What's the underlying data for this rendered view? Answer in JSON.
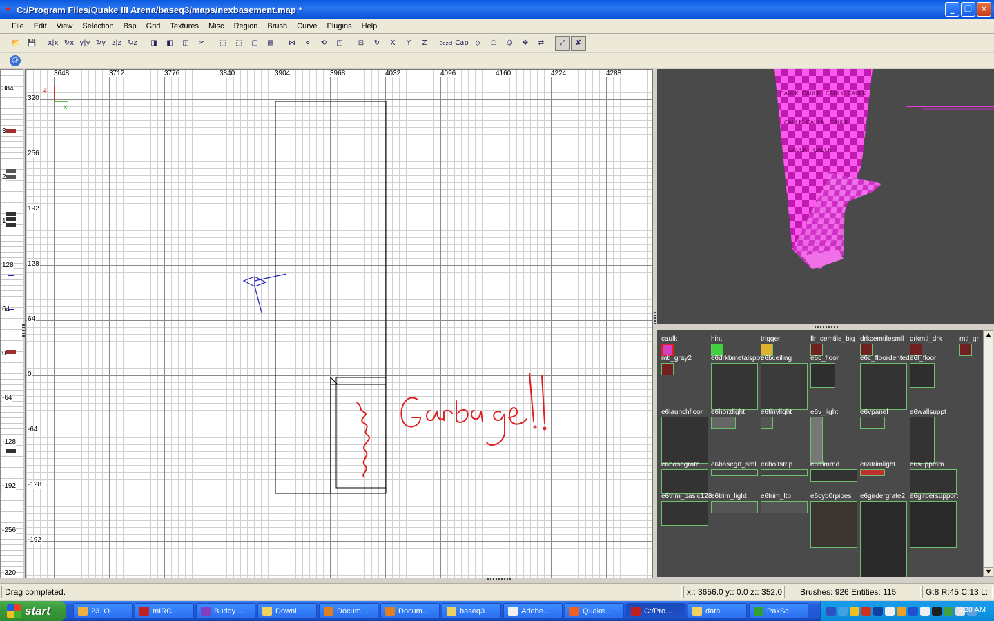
{
  "window": {
    "title": "C:/Program Files/Quake III Arena/baseq3/maps/nexbasement.map *",
    "minimize": "_",
    "maximize": "❐",
    "close": "✕"
  },
  "menu": [
    "File",
    "Edit",
    "View",
    "Selection",
    "Bsp",
    "Grid",
    "Textures",
    "Misc",
    "Region",
    "Brush",
    "Curve",
    "Plugins",
    "Help"
  ],
  "toolbar": {
    "icons": [
      "open-icon",
      "save-icon",
      "flip-x-icon",
      "rotate-x-icon",
      "flip-y-icon",
      "rotate-y-icon",
      "flip-z-icon",
      "rotate-z-icon",
      "csg-subtract-icon",
      "csg-merge-icon",
      "make-hollow-icon",
      "clipper-icon",
      "select-touching-icon",
      "select-partial-icon",
      "select-inside-icon",
      "select-complete-icon",
      "drag-edge-icon",
      "drag-vertex-icon",
      "show-textures-icon",
      "cubic-clip-icon",
      "camera-mode-icon",
      "view-change-icon",
      "view-x-icon",
      "view-y-icon",
      "view-z-icon",
      "show-patch-icon",
      "show-entity-icon",
      "texture-lock-icon",
      "rotate-lock-icon",
      "bend-icon",
      "camera-move-icon",
      "scale-icon",
      "drag-mode-icon",
      "redisperse-icon"
    ],
    "glyphs": [
      "📂",
      "💾",
      "x|x",
      "↻x",
      "y|y",
      "↻y",
      "z|z",
      "↻z",
      "◨",
      "◧",
      "◫",
      "✂",
      "⬚",
      "⬚",
      "▢",
      "▤",
      "⋈",
      "⋄",
      "⟲",
      "◰",
      "⊡",
      "↻",
      "X",
      "Y",
      "Z",
      "Bezel",
      "Cap",
      "◇",
      "☖",
      "⌬",
      "✥",
      "⇄",
      "⤢",
      "✘"
    ],
    "active": [
      32,
      33
    ],
    "patch_icon_glyph": "@"
  },
  "zruler": {
    "labels": [
      "384",
      "3",
      "2",
      "1",
      "128",
      "64",
      "0",
      "-64",
      "-128",
      "-192",
      "-256",
      "-320"
    ]
  },
  "view2d": {
    "x_ticks": [
      "3648",
      "3712",
      "3776",
      "3840",
      "3904",
      "3968",
      "4032",
      "4096",
      "4160",
      "4224",
      "4288"
    ],
    "y_ticks": [
      "320",
      "256",
      "192",
      "128",
      "64",
      "0",
      "-64",
      "-128",
      "-192"
    ],
    "axis_vertical": "z",
    "axis_horizontal": "x",
    "annotation": "Garbage!!"
  },
  "camera": {
    "texture_text": "CAULK"
  },
  "textures": [
    {
      "name": "caulk",
      "selected": true
    },
    {
      "name": "hint"
    },
    {
      "name": "trigger"
    },
    {
      "name": "flr_cemtile_big"
    },
    {
      "name": "drkcemtilesmll"
    },
    {
      "name": "drkmtl_drk"
    },
    {
      "name": "mtl_gr"
    },
    {
      "name": "mtl_gray2"
    },
    {
      "name": "e6drkbmetalspot"
    },
    {
      "name": "e6bceiling"
    },
    {
      "name": "e6c_floor"
    },
    {
      "name": "e6c_floordented"
    },
    {
      "name": "e6l_floor"
    },
    {
      "name": "e6launchfloor"
    },
    {
      "name": "e6horzlight"
    },
    {
      "name": "e6tinylight"
    },
    {
      "name": "e6v_light"
    },
    {
      "name": "e6vpanel"
    },
    {
      "name": "e6wallsuppt"
    },
    {
      "name": "e6basegrate"
    },
    {
      "name": "e6basegrt_sml"
    },
    {
      "name": "e6boltstrip"
    },
    {
      "name": "e6trimrnd"
    },
    {
      "name": "e6strimlight"
    },
    {
      "name": "e6supptrim"
    },
    {
      "name": "e6trim_basic128"
    },
    {
      "name": "e6trim_light"
    },
    {
      "name": "e6trim_ltb"
    },
    {
      "name": "e6cyb0rpipes"
    },
    {
      "name": "e6girdergrate2"
    },
    {
      "name": "e6girdersupport"
    }
  ],
  "status": {
    "message": "Drag completed.",
    "coords": "x:: 3656.0  y:: 0.0  z:: 352.0",
    "counts": "Brushes: 926 Entities: 115",
    "grid": "G:8 R:45 C:13 L:"
  },
  "taskbar": {
    "start": "start",
    "buttons": [
      "23. O...",
      "mIRC ...",
      "Buddy ...",
      "Downl...",
      "Docum...",
      "Docum...",
      "baseq3",
      "Adobe...",
      "Quake...",
      "C:/Pro...",
      "data",
      "PakSc..."
    ],
    "button_colors": [
      "#f0b040",
      "#c02020",
      "#8040c0",
      "#f0d060",
      "#e08020",
      "#e08020",
      "#f0d060",
      "#f0f0f0",
      "#f06020",
      "#c02020",
      "#f0d060",
      "#30a030"
    ],
    "active_index": 9,
    "tray_colors": [
      "#3050c0",
      "#40a0e0",
      "#f0c020",
      "#d03020",
      "#1040a0",
      "#f0f0f0",
      "#f0a020",
      "#2050d0",
      "#f0f0f0",
      "#202020",
      "#40a040",
      "#e0e0e0",
      "#60a0e0"
    ],
    "clock": "5:28 AM"
  }
}
